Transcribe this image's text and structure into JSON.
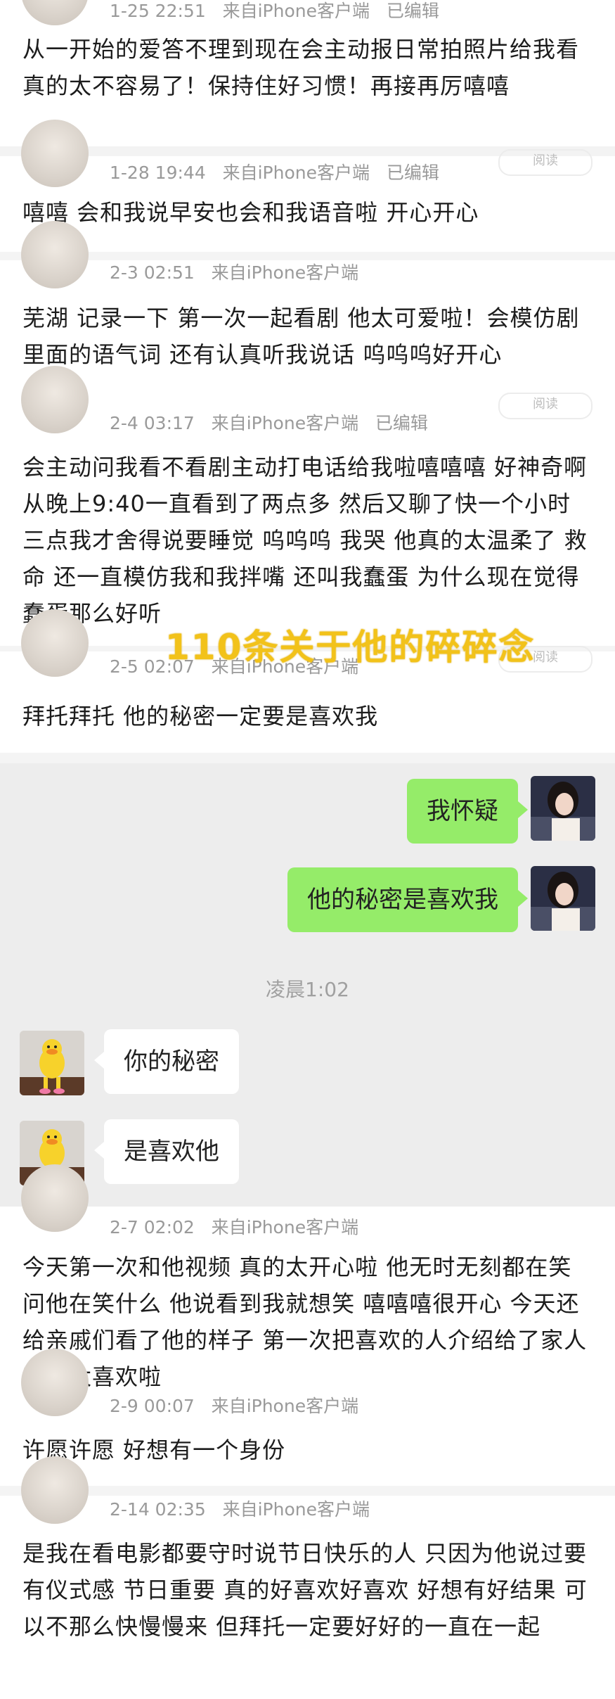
{
  "posts": [
    {
      "time": "1-25 22:51",
      "source_prefix": "来自",
      "source": "iPhone客户端",
      "edited": "已编辑",
      "body": "从一开始的爱答不理到现在会主动报日常拍照片给我看 真的太不容易了！保持住好习惯！再接再厉嘻嘻"
    },
    {
      "time": "1-28 19:44",
      "source_prefix": "来自",
      "source": "iPhone客户端",
      "edited": "已编辑",
      "read": "阅读",
      "body": "嘻嘻 会和我说早安也会和我语音啦 开心开心"
    },
    {
      "time": "2-3 02:51",
      "source_prefix": "来自",
      "source": "iPhone客户端",
      "body": "芜湖 记录一下 第一次一起看剧 他太可爱啦！会模仿剧里面的语气词 还有认真听我说话 呜呜呜好开心"
    },
    {
      "time": "2-4 03:17",
      "source_prefix": "来自",
      "source": "iPhone客户端",
      "edited": "已编辑",
      "read": "阅读",
      "body": "会主动问我看不看剧主动打电话给我啦嘻嘻嘻 好神奇啊 从晚上9:40一直看到了两点多 然后又聊了快一个小时 三点我才舍得说要睡觉 呜呜呜 我哭 他真的太温柔了 救命 还一直模仿我和我拌嘴 还叫我蠢蛋 为什么现在觉得蠢蛋那么好听"
    },
    {
      "time": "2-5 02:07",
      "source_prefix": "来自",
      "source": "iPhone客户端",
      "read": "阅读",
      "body": "拜托拜托 他的秘密一定要是喜欢我"
    },
    {
      "time": "2-7 02:02",
      "source_prefix": "来自",
      "source": "iPhone客户端",
      "body": "今天第一次和他视频 真的太开心啦 他无时无刻都在笑 问他在笑什么 他说看到我就想笑 嘻嘻嘻很开心 今天还给亲戚们看了他的样子 第一次把喜欢的人介绍给了家人 真的太喜欢啦"
    },
    {
      "time": "2-9 00:07",
      "source_prefix": "来自",
      "source": "iPhone客户端",
      "body": "许愿许愿 好想有一个身份"
    },
    {
      "time": "2-14 02:35",
      "source_prefix": "来自",
      "source": "iPhone客户端",
      "body": "是我在看电影都要守时说节日快乐的人 只因为他说过要有仪式感 节日重要 真的好喜欢好喜欢 好想有好结果 可以不那么快慢慢来 但拜托一定要好好的一直在一起"
    }
  ],
  "watermark": "110条关于他的碎碎念",
  "chat": {
    "messages": [
      {
        "from": "me",
        "text": "我怀疑"
      },
      {
        "from": "me",
        "text": "他的秘密是喜欢我"
      },
      {
        "from": "other",
        "text": "你的秘密"
      },
      {
        "from": "other",
        "text": "是喜欢他"
      }
    ],
    "timestamp": "凌晨1:02"
  },
  "colors": {
    "my_bubble": "#95ec69",
    "other_bubble": "#ffffff",
    "chat_bg": "#ededed",
    "watermark": "#f2c21a"
  },
  "icons": {
    "my_avatar": "girl-photo-avatar",
    "other_avatar": "yellow-duck-plush-avatar"
  }
}
